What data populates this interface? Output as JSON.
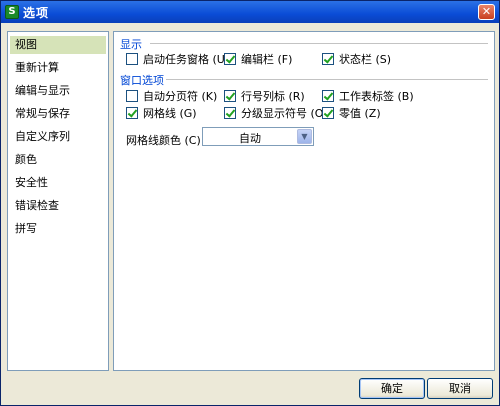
{
  "window": {
    "title": "选项",
    "app_icon_letter": "S",
    "close_glyph": "✕"
  },
  "sidebar": {
    "items": [
      {
        "label": "视图",
        "active": true
      },
      {
        "label": "重新计算"
      },
      {
        "label": "编辑与显示"
      },
      {
        "label": "常规与保存"
      },
      {
        "label": "自定义序列"
      },
      {
        "label": "颜色"
      },
      {
        "label": "安全性"
      },
      {
        "label": "错误检查"
      },
      {
        "label": "拼写"
      }
    ]
  },
  "display": {
    "title": "显示",
    "options": [
      {
        "label": "启动任务窗格 (U)",
        "checked": false
      },
      {
        "label": "编辑栏 (F)",
        "checked": true
      },
      {
        "label": "状态栏 (S)",
        "checked": true
      }
    ]
  },
  "window_options": {
    "title": "窗口选项",
    "options": [
      {
        "label": "自动分页符 (K)",
        "checked": false
      },
      {
        "label": "行号列标 (R)",
        "checked": true
      },
      {
        "label": "工作表标签 (B)",
        "checked": true
      },
      {
        "label": "网格线 (G)",
        "checked": true
      },
      {
        "label": "分级显示符号 (O)",
        "checked": true
      },
      {
        "label": "零值 (Z)",
        "checked": true
      }
    ],
    "gridline_color_label": "网格线颜色 (C):",
    "gridline_color_value": "自动",
    "dropdown_glyph": "▼"
  },
  "buttons": {
    "ok": "确定",
    "cancel": "取消"
  }
}
